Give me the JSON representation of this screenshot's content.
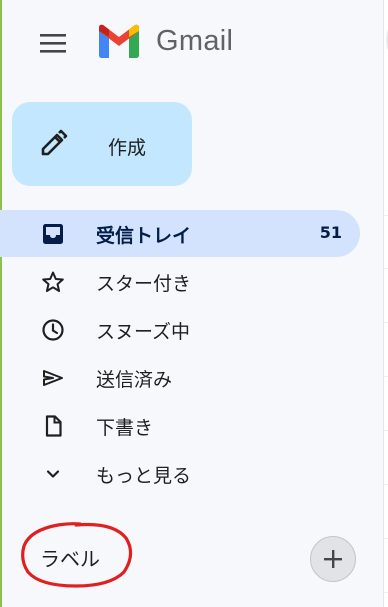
{
  "header": {
    "app_name": "Gmail"
  },
  "compose": {
    "label": "作成"
  },
  "nav": {
    "items": [
      {
        "label": "受信トレイ",
        "count": "51",
        "icon": "inbox-icon",
        "active": true
      },
      {
        "label": "スター付き",
        "icon": "star-icon"
      },
      {
        "label": "スヌーズ中",
        "icon": "clock-icon"
      },
      {
        "label": "送信済み",
        "icon": "send-icon"
      },
      {
        "label": "下書き",
        "icon": "draft-icon"
      },
      {
        "label": "もっと見る",
        "icon": "chevron-down-icon"
      }
    ]
  },
  "labels": {
    "title": "ラベル"
  },
  "colors": {
    "background": "#f6f8fc",
    "compose_bg": "#c2e7ff",
    "active_bg": "#d3e3fd",
    "annotation": "#e02020"
  }
}
